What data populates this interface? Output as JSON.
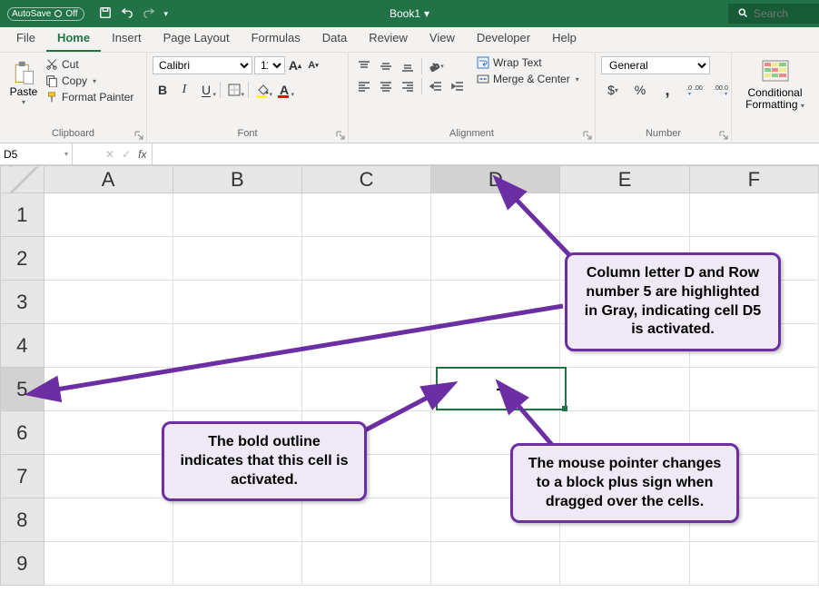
{
  "titlebar": {
    "autosave_label": "AutoSave",
    "autosave_state": "Off",
    "doc_title": "Book1",
    "search_placeholder": "Search"
  },
  "tabs": {
    "items": [
      "File",
      "Home",
      "Insert",
      "Page Layout",
      "Formulas",
      "Data",
      "Review",
      "View",
      "Developer",
      "Help"
    ],
    "active": "Home"
  },
  "ribbon": {
    "clipboard": {
      "label": "Clipboard",
      "paste": "Paste",
      "cut": "Cut",
      "copy": "Copy",
      "format_painter": "Format Painter"
    },
    "font": {
      "label": "Font",
      "name": "Calibri",
      "size": "11",
      "bold": "B",
      "italic": "I",
      "underline": "U"
    },
    "alignment": {
      "label": "Alignment",
      "wrap": "Wrap Text",
      "merge": "Merge & Center"
    },
    "number": {
      "label": "Number",
      "format": "General"
    },
    "conditional": {
      "line1": "Conditional",
      "line2": "Formatting"
    }
  },
  "formula_bar": {
    "cell_ref": "D5",
    "fx": "fx",
    "formula": ""
  },
  "grid": {
    "columns": [
      "A",
      "B",
      "C",
      "D",
      "E",
      "F"
    ],
    "rows": [
      "1",
      "2",
      "3",
      "4",
      "5",
      "6",
      "7",
      "8",
      "9"
    ],
    "active_col": "D",
    "active_row": "5"
  },
  "callouts": {
    "top_right": "Column letter D and Row number 5 are highlighted in Gray, indicating cell D5 is activated.",
    "bottom_left": "The bold outline indicates that this cell is activated.",
    "bottom_right": "The mouse pointer changes to a block plus sign when dragged over the cells."
  },
  "colors": {
    "excel_green": "#217346",
    "callout_purple": "#6b2fa3",
    "callout_fill": "#eee9f4"
  }
}
